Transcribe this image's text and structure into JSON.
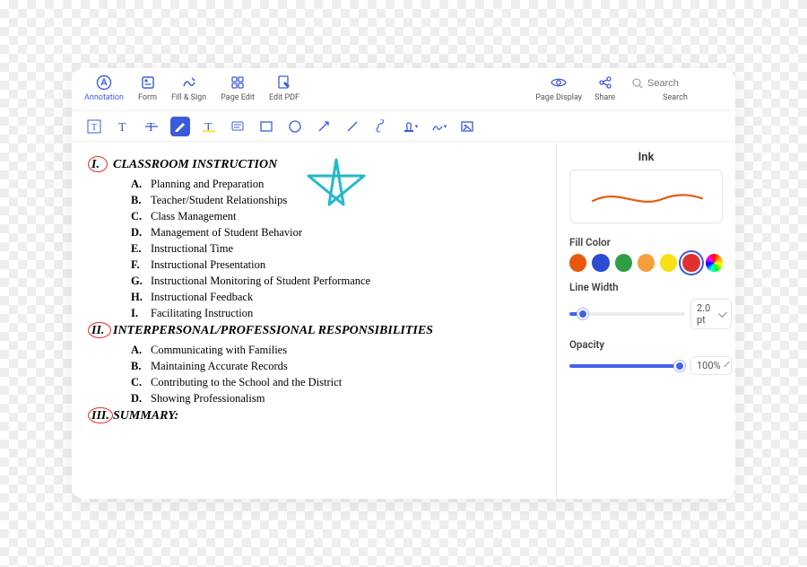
{
  "toolbar": {
    "annotation": "Annotation",
    "form": "Form",
    "fillsign": "Fill & Sign",
    "pageedit": "Page Edit",
    "editpdf": "Edit PDF",
    "pagedisplay": "Page Display",
    "share": "Share",
    "search_placeholder": "Search",
    "search_label": "Search"
  },
  "ink_panel": {
    "title": "Ink",
    "fillcolor_label": "Fill Color",
    "linewidth_label": "Line Width",
    "linewidth_value": "2.0 pt",
    "opacity_label": "Opacity",
    "opacity_value": "100%",
    "colors": [
      {
        "hex": "#e8590c"
      },
      {
        "hex": "#2b4bd1"
      },
      {
        "hex": "#2f9e44"
      },
      {
        "hex": "#f59f3b"
      },
      {
        "hex": "#f7e017"
      },
      {
        "hex": "#e03131",
        "selected": true
      },
      {
        "hex": "conic-gradient(red,orange,yellow,lime,cyan,blue,magenta,red)"
      }
    ]
  },
  "document": {
    "sections": [
      {
        "num": "I.",
        "title": "CLASSROOM INSTRUCTION",
        "items": [
          {
            "letter": "A.",
            "text": "Planning and Preparation"
          },
          {
            "letter": "B.",
            "text": "Teacher/Student Relationships"
          },
          {
            "letter": "C.",
            "text": "Class Management"
          },
          {
            "letter": "D.",
            "text": "Management of Student Behavior"
          },
          {
            "letter": "E.",
            "text": "Instructional Time"
          },
          {
            "letter": "F.",
            "text": "Instructional Presentation"
          },
          {
            "letter": "G.",
            "text": "Instructional Monitoring of Student Performance"
          },
          {
            "letter": "H.",
            "text": "Instructional Feedback"
          },
          {
            "letter": "I.",
            "text": "Facilitating Instruction"
          }
        ]
      },
      {
        "num": "II.",
        "title": "INTERPERSONAL/PROFESSIONAL RESPONSIBILITIES",
        "items": [
          {
            "letter": "A.",
            "text": "Communicating with Families"
          },
          {
            "letter": "B.",
            "text": "Maintaining Accurate Records"
          },
          {
            "letter": "C.",
            "text": "Contributing to the School and the District"
          },
          {
            "letter": "D.",
            "text": "Showing Professionalism"
          }
        ]
      },
      {
        "num": "III.",
        "title": "SUMMARY:",
        "items": []
      }
    ]
  }
}
